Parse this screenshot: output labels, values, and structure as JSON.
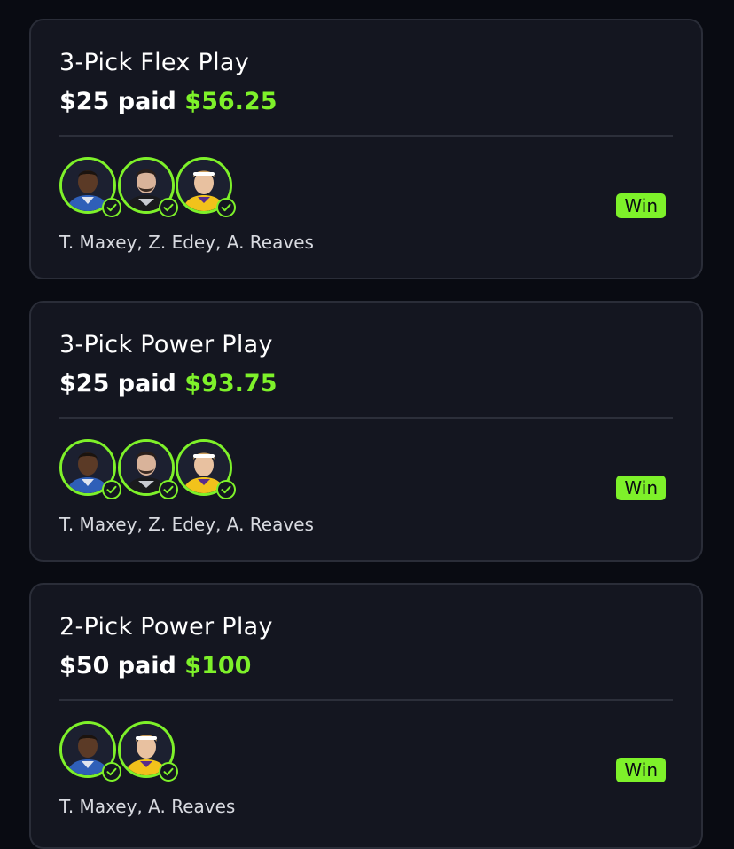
{
  "colors": {
    "background": "#090b12",
    "card": "#141620",
    "accent_green": "#7ef12a"
  },
  "cards": [
    {
      "title": "3-Pick Flex Play",
      "paid_label": "$25 paid",
      "payout": "$56.25",
      "players": "T. Maxey, Z. Edey, A. Reaves",
      "status": "Win",
      "avatars": [
        "maxey-avatar",
        "edey-avatar",
        "reaves-avatar"
      ]
    },
    {
      "title": "3-Pick Power Play",
      "paid_label": "$25 paid",
      "payout": "$93.75",
      "players": "T. Maxey, Z. Edey, A. Reaves",
      "status": "Win",
      "avatars": [
        "maxey-avatar",
        "edey-avatar",
        "reaves-avatar"
      ]
    },
    {
      "title": "2-Pick Power Play",
      "paid_label": "$50 paid",
      "payout": "$100",
      "players": "T. Maxey, A. Reaves",
      "status": "Win",
      "avatars": [
        "maxey-avatar",
        "reaves-avatar"
      ]
    }
  ]
}
